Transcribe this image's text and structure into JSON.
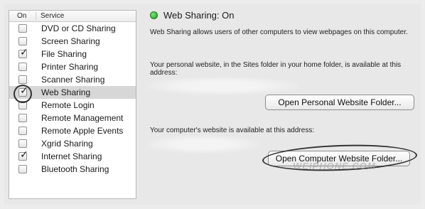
{
  "services_panel": {
    "header_on": "On",
    "header_service": "Service",
    "items": [
      {
        "label": "DVD or CD Sharing",
        "checked": false,
        "selected": false
      },
      {
        "label": "Screen Sharing",
        "checked": false,
        "selected": false
      },
      {
        "label": "File Sharing",
        "checked": true,
        "selected": false
      },
      {
        "label": "Printer Sharing",
        "checked": false,
        "selected": false
      },
      {
        "label": "Scanner Sharing",
        "checked": false,
        "selected": false
      },
      {
        "label": "Web Sharing",
        "checked": true,
        "selected": true
      },
      {
        "label": "Remote Login",
        "checked": false,
        "selected": false
      },
      {
        "label": "Remote Management",
        "checked": false,
        "selected": false
      },
      {
        "label": "Remote Apple Events",
        "checked": false,
        "selected": false
      },
      {
        "label": "Xgrid Sharing",
        "checked": false,
        "selected": false
      },
      {
        "label": "Internet Sharing",
        "checked": true,
        "selected": false
      },
      {
        "label": "Bluetooth Sharing",
        "checked": false,
        "selected": false
      }
    ]
  },
  "detail": {
    "status": "Web Sharing: On",
    "status_color": "#2aa52a",
    "description": "Web Sharing allows users of other computers to view webpages on this computer.",
    "personal_text": "Your personal website, in the Sites folder in your home folder, is available at this address:",
    "open_personal_button": "Open Personal Website Folder...",
    "computer_text": "Your computer's website is available at this address:",
    "open_computer_button": "Open Computer Website Folder..."
  },
  "watermark": "WEIPHONE.COM"
}
